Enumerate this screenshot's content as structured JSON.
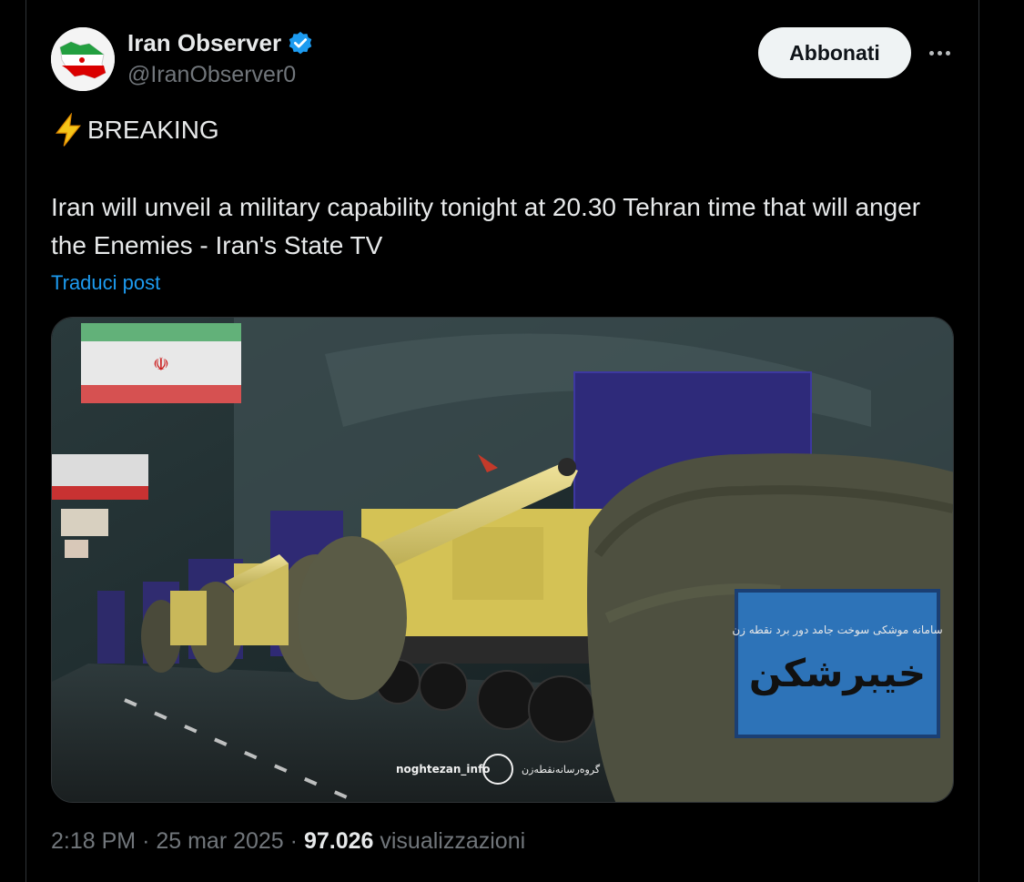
{
  "author": {
    "name": "Iran Observer",
    "handle": "@IranObserver0",
    "verified": true
  },
  "actions": {
    "follow_label": "Abbonati"
  },
  "post": {
    "headline": "BREAKING",
    "body": "Iran will unveil a military capability tonight at 20.30 Tehran time that will anger the Enemies - Iran's State TV",
    "translate_label": "Traduci post"
  },
  "media": {
    "watermark": "noghtezan_info",
    "watermark_fa": "گروه‌رسانه‌نقطه‌زن",
    "sign_title": "خیبرشکن",
    "sign_subtitle": "سامانه موشکی سوخت جامد دور برد نقطه زن"
  },
  "meta": {
    "time": "2:18 PM",
    "separator": "·",
    "date": "25 mar 2025",
    "views_count": "97.026",
    "views_label": "visualizzazioni"
  },
  "colors": {
    "accent": "#1d9bf0",
    "verified": "#1d9bf0",
    "background": "#000000"
  },
  "icons": {
    "verified": "verified-badge-icon",
    "more": "more-dots-icon",
    "bolt": "lightning-bolt-icon"
  }
}
